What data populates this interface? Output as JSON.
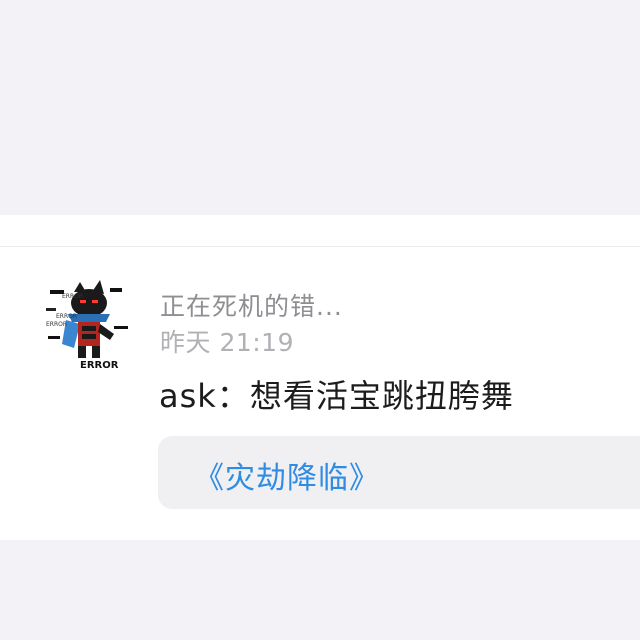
{
  "post": {
    "username": "正在死机的错...",
    "time": "昨天 21:19",
    "message": "ask：想看活宝跳扭胯舞",
    "quote_link": "《灾劫降临》"
  },
  "avatar": {
    "icon": "error-character-avatar",
    "error_text": "ERROR"
  },
  "colors": {
    "background": "#f2f2f7",
    "card": "#ffffff",
    "username": "#8e8e93",
    "timestamp": "#b0b0b5",
    "message": "#1c1c1e",
    "quote_background": "#f0f0f3",
    "link": "#2f8ce2"
  }
}
